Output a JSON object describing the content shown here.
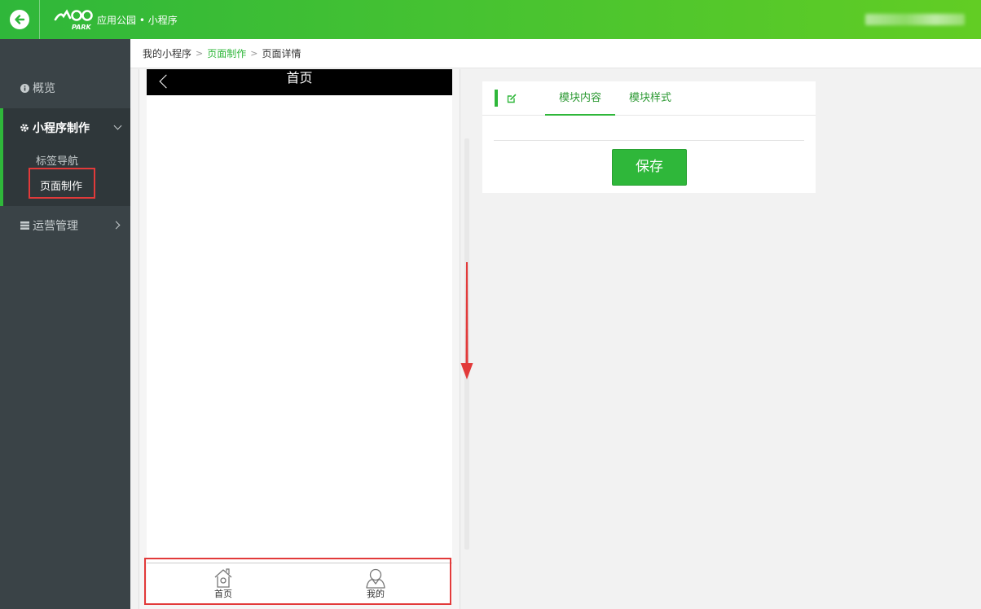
{
  "header": {
    "app_title": "应用公园 • 小程序",
    "logo_text": "PARK",
    "back_icon": "back-arrow-icon"
  },
  "sidebar": {
    "overview_label": "概览",
    "group_label": "小程序制作",
    "sub_items": [
      "标签导航",
      "页面制作"
    ],
    "ops_label": "运营管理"
  },
  "breadcrumb": [
    "我的小程序",
    "页面制作",
    "页面详情"
  ],
  "phone": {
    "title": "首页",
    "tabs": [
      {
        "label": "首页",
        "icon": "home-icon"
      },
      {
        "label": "我的",
        "icon": "user-icon"
      }
    ]
  },
  "editor": {
    "tabs": [
      "模块内容",
      "模块样式"
    ],
    "save_label": "保存"
  },
  "colors": {
    "accent": "#2fb73a",
    "sidebar": "#3a4347",
    "highlight": "#e23a3a"
  }
}
